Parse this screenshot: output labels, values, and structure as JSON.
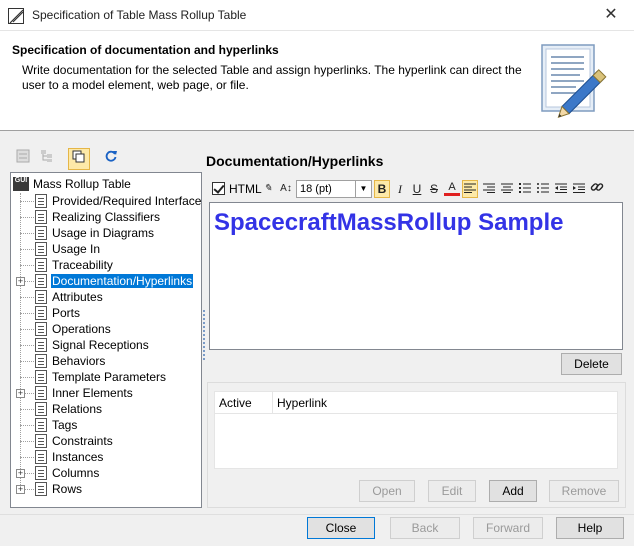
{
  "window": {
    "title": "Specification of Table Mass Rollup Table",
    "close_glyph": "✕"
  },
  "header": {
    "title": "Specification of documentation and hyperlinks",
    "description": "Write documentation for the selected Table and assign hyperlinks. The hyperlink can direct the user to a model element, web page, or file."
  },
  "tree": {
    "root": {
      "label": "Mass Rollup Table",
      "icon_text": "GUI"
    },
    "items": [
      {
        "label": "Provided/Required Interfaces",
        "expandable": false
      },
      {
        "label": "Realizing Classifiers",
        "expandable": false
      },
      {
        "label": "Usage in Diagrams",
        "expandable": false
      },
      {
        "label": "Usage In",
        "expandable": false
      },
      {
        "label": "Traceability",
        "expandable": false
      },
      {
        "label": "Documentation/Hyperlinks",
        "expandable": true,
        "selected": true
      },
      {
        "label": "Attributes",
        "expandable": false
      },
      {
        "label": "Ports",
        "expandable": false
      },
      {
        "label": "Operations",
        "expandable": false
      },
      {
        "label": "Signal Receptions",
        "expandable": false
      },
      {
        "label": "Behaviors",
        "expandable": false
      },
      {
        "label": "Template Parameters",
        "expandable": false
      },
      {
        "label": "Inner Elements",
        "expandable": true
      },
      {
        "label": "Relations",
        "expandable": false
      },
      {
        "label": "Tags",
        "expandable": false
      },
      {
        "label": "Constraints",
        "expandable": false
      },
      {
        "label": "Instances",
        "expandable": false
      },
      {
        "label": "Columns",
        "expandable": true
      },
      {
        "label": "Rows",
        "expandable": true
      }
    ]
  },
  "main": {
    "section_title": "Documentation/Hyperlinks",
    "editor": {
      "html_label": "HTML",
      "html_checked": true,
      "font_size": "18 (pt)",
      "text": "SpacecraftMassRollup Sample",
      "text_color": "#3333e6"
    },
    "delete_label": "Delete",
    "hyperlinks": {
      "columns": [
        "Active",
        "Hyperlink"
      ],
      "open_label": "Open",
      "edit_label": "Edit",
      "add_label": "Add",
      "remove_label": "Remove"
    }
  },
  "footer": {
    "close_label": "Close",
    "back_label": "Back",
    "forward_label": "Forward",
    "help_label": "Help"
  },
  "colors": {
    "selection": "#0078d7",
    "toggle_active": "#fde9a8"
  }
}
